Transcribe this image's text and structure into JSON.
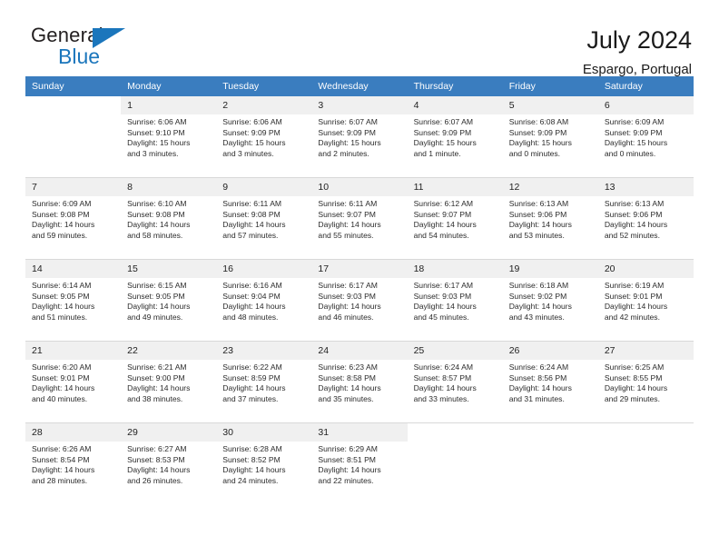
{
  "brand": {
    "name_part1": "General",
    "name_part2": "Blue",
    "flag_icon": "triangle-flag-icon",
    "accent_color": "#1b76bc"
  },
  "header": {
    "title": "July 2024",
    "subtitle": "Espargo, Portugal"
  },
  "calendar": {
    "header_color": "#3a7dbf",
    "weekdays": [
      "Sunday",
      "Monday",
      "Tuesday",
      "Wednesday",
      "Thursday",
      "Friday",
      "Saturday"
    ],
    "labels": {
      "sunrise": "Sunrise:",
      "sunset": "Sunset:",
      "daylight": "Daylight:"
    },
    "weeks": [
      [
        {
          "day": "",
          "l1": "",
          "l2": "",
          "l3": "",
          "l4": ""
        },
        {
          "day": "1",
          "l1": "Sunrise: 6:06 AM",
          "l2": "Sunset: 9:10 PM",
          "l3": "Daylight: 15 hours",
          "l4": "and 3 minutes."
        },
        {
          "day": "2",
          "l1": "Sunrise: 6:06 AM",
          "l2": "Sunset: 9:09 PM",
          "l3": "Daylight: 15 hours",
          "l4": "and 3 minutes."
        },
        {
          "day": "3",
          "l1": "Sunrise: 6:07 AM",
          "l2": "Sunset: 9:09 PM",
          "l3": "Daylight: 15 hours",
          "l4": "and 2 minutes."
        },
        {
          "day": "4",
          "l1": "Sunrise: 6:07 AM",
          "l2": "Sunset: 9:09 PM",
          "l3": "Daylight: 15 hours",
          "l4": "and 1 minute."
        },
        {
          "day": "5",
          "l1": "Sunrise: 6:08 AM",
          "l2": "Sunset: 9:09 PM",
          "l3": "Daylight: 15 hours",
          "l4": "and 0 minutes."
        },
        {
          "day": "6",
          "l1": "Sunrise: 6:09 AM",
          "l2": "Sunset: 9:09 PM",
          "l3": "Daylight: 15 hours",
          "l4": "and 0 minutes."
        }
      ],
      [
        {
          "day": "7",
          "l1": "Sunrise: 6:09 AM",
          "l2": "Sunset: 9:08 PM",
          "l3": "Daylight: 14 hours",
          "l4": "and 59 minutes."
        },
        {
          "day": "8",
          "l1": "Sunrise: 6:10 AM",
          "l2": "Sunset: 9:08 PM",
          "l3": "Daylight: 14 hours",
          "l4": "and 58 minutes."
        },
        {
          "day": "9",
          "l1": "Sunrise: 6:11 AM",
          "l2": "Sunset: 9:08 PM",
          "l3": "Daylight: 14 hours",
          "l4": "and 57 minutes."
        },
        {
          "day": "10",
          "l1": "Sunrise: 6:11 AM",
          "l2": "Sunset: 9:07 PM",
          "l3": "Daylight: 14 hours",
          "l4": "and 55 minutes."
        },
        {
          "day": "11",
          "l1": "Sunrise: 6:12 AM",
          "l2": "Sunset: 9:07 PM",
          "l3": "Daylight: 14 hours",
          "l4": "and 54 minutes."
        },
        {
          "day": "12",
          "l1": "Sunrise: 6:13 AM",
          "l2": "Sunset: 9:06 PM",
          "l3": "Daylight: 14 hours",
          "l4": "and 53 minutes."
        },
        {
          "day": "13",
          "l1": "Sunrise: 6:13 AM",
          "l2": "Sunset: 9:06 PM",
          "l3": "Daylight: 14 hours",
          "l4": "and 52 minutes."
        }
      ],
      [
        {
          "day": "14",
          "l1": "Sunrise: 6:14 AM",
          "l2": "Sunset: 9:05 PM",
          "l3": "Daylight: 14 hours",
          "l4": "and 51 minutes."
        },
        {
          "day": "15",
          "l1": "Sunrise: 6:15 AM",
          "l2": "Sunset: 9:05 PM",
          "l3": "Daylight: 14 hours",
          "l4": "and 49 minutes."
        },
        {
          "day": "16",
          "l1": "Sunrise: 6:16 AM",
          "l2": "Sunset: 9:04 PM",
          "l3": "Daylight: 14 hours",
          "l4": "and 48 minutes."
        },
        {
          "day": "17",
          "l1": "Sunrise: 6:17 AM",
          "l2": "Sunset: 9:03 PM",
          "l3": "Daylight: 14 hours",
          "l4": "and 46 minutes."
        },
        {
          "day": "18",
          "l1": "Sunrise: 6:17 AM",
          "l2": "Sunset: 9:03 PM",
          "l3": "Daylight: 14 hours",
          "l4": "and 45 minutes."
        },
        {
          "day": "19",
          "l1": "Sunrise: 6:18 AM",
          "l2": "Sunset: 9:02 PM",
          "l3": "Daylight: 14 hours",
          "l4": "and 43 minutes."
        },
        {
          "day": "20",
          "l1": "Sunrise: 6:19 AM",
          "l2": "Sunset: 9:01 PM",
          "l3": "Daylight: 14 hours",
          "l4": "and 42 minutes."
        }
      ],
      [
        {
          "day": "21",
          "l1": "Sunrise: 6:20 AM",
          "l2": "Sunset: 9:01 PM",
          "l3": "Daylight: 14 hours",
          "l4": "and 40 minutes."
        },
        {
          "day": "22",
          "l1": "Sunrise: 6:21 AM",
          "l2": "Sunset: 9:00 PM",
          "l3": "Daylight: 14 hours",
          "l4": "and 38 minutes."
        },
        {
          "day": "23",
          "l1": "Sunrise: 6:22 AM",
          "l2": "Sunset: 8:59 PM",
          "l3": "Daylight: 14 hours",
          "l4": "and 37 minutes."
        },
        {
          "day": "24",
          "l1": "Sunrise: 6:23 AM",
          "l2": "Sunset: 8:58 PM",
          "l3": "Daylight: 14 hours",
          "l4": "and 35 minutes."
        },
        {
          "day": "25",
          "l1": "Sunrise: 6:24 AM",
          "l2": "Sunset: 8:57 PM",
          "l3": "Daylight: 14 hours",
          "l4": "and 33 minutes."
        },
        {
          "day": "26",
          "l1": "Sunrise: 6:24 AM",
          "l2": "Sunset: 8:56 PM",
          "l3": "Daylight: 14 hours",
          "l4": "and 31 minutes."
        },
        {
          "day": "27",
          "l1": "Sunrise: 6:25 AM",
          "l2": "Sunset: 8:55 PM",
          "l3": "Daylight: 14 hours",
          "l4": "and 29 minutes."
        }
      ],
      [
        {
          "day": "28",
          "l1": "Sunrise: 6:26 AM",
          "l2": "Sunset: 8:54 PM",
          "l3": "Daylight: 14 hours",
          "l4": "and 28 minutes."
        },
        {
          "day": "29",
          "l1": "Sunrise: 6:27 AM",
          "l2": "Sunset: 8:53 PM",
          "l3": "Daylight: 14 hours",
          "l4": "and 26 minutes."
        },
        {
          "day": "30",
          "l1": "Sunrise: 6:28 AM",
          "l2": "Sunset: 8:52 PM",
          "l3": "Daylight: 14 hours",
          "l4": "and 24 minutes."
        },
        {
          "day": "31",
          "l1": "Sunrise: 6:29 AM",
          "l2": "Sunset: 8:51 PM",
          "l3": "Daylight: 14 hours",
          "l4": "and 22 minutes."
        },
        {
          "day": "",
          "l1": "",
          "l2": "",
          "l3": "",
          "l4": ""
        },
        {
          "day": "",
          "l1": "",
          "l2": "",
          "l3": "",
          "l4": ""
        },
        {
          "day": "",
          "l1": "",
          "l2": "",
          "l3": "",
          "l4": ""
        }
      ]
    ]
  }
}
